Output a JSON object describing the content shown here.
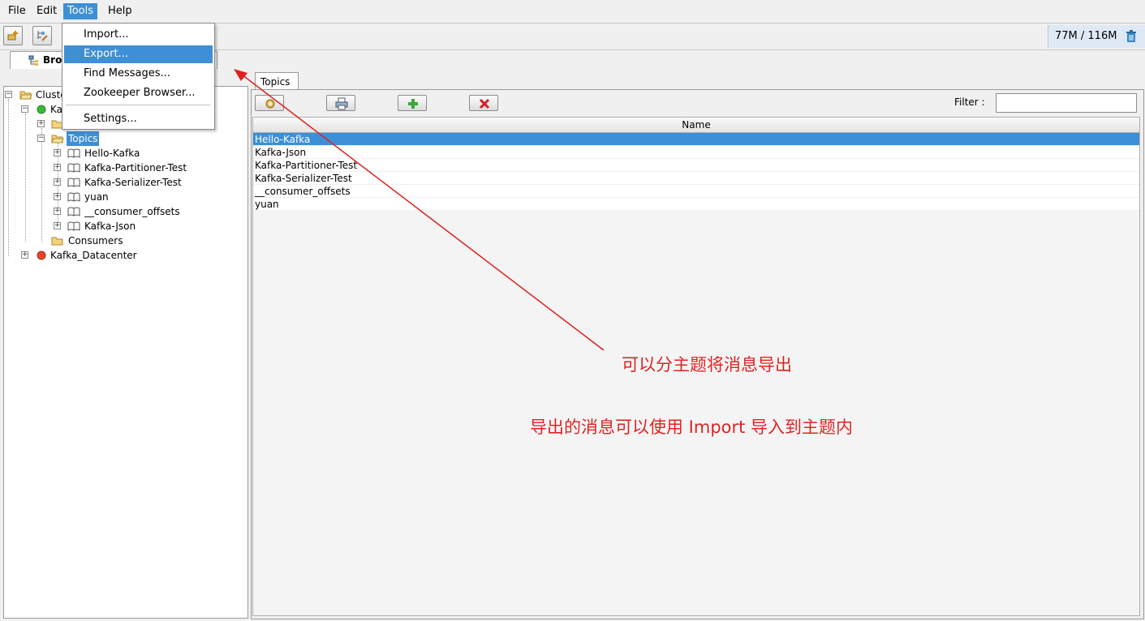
{
  "menubar": {
    "file": "File",
    "edit": "Edit",
    "tools": "Tools",
    "help": "Help"
  },
  "toolbar": {
    "memory": "77M / 116M"
  },
  "main_tab": {
    "label": "Bro"
  },
  "tree": {
    "root": "Cluste",
    "cluster1": "Ka",
    "topics": "Topics",
    "topic_items": [
      "Hello-Kafka",
      "Kafka-Partitioner-Test",
      "Kafka-Serializer-Test",
      "yuan",
      "__consumer_offsets",
      "Kafka-Json"
    ],
    "consumers": "Consumers",
    "cluster2": "Kafka_Datacenter"
  },
  "right": {
    "tab": "Topics",
    "filter_label": "Filter :",
    "filter_value": "",
    "column_name": "Name",
    "rows": [
      "Hello-Kafka",
      "Kafka-Json",
      "Kafka-Partitioner-Test",
      "Kafka-Serializer-Test",
      "__consumer_offsets",
      "yuan"
    ]
  },
  "tools_menu": {
    "items": [
      "Import...",
      "Export...",
      "Find Messages...",
      "Zookeeper Browser...",
      "Settings..."
    ],
    "highlighted_index": 1
  },
  "annotations": {
    "line1": "可以分主题将消息导出",
    "line2": "导出的消息可以使用 Import 导入到主题内"
  },
  "colors": {
    "selection": "#3d8fd6",
    "annotation": "#e02020",
    "connected_dot": "#3cb83c",
    "disconnected_dot": "#e8442a"
  }
}
